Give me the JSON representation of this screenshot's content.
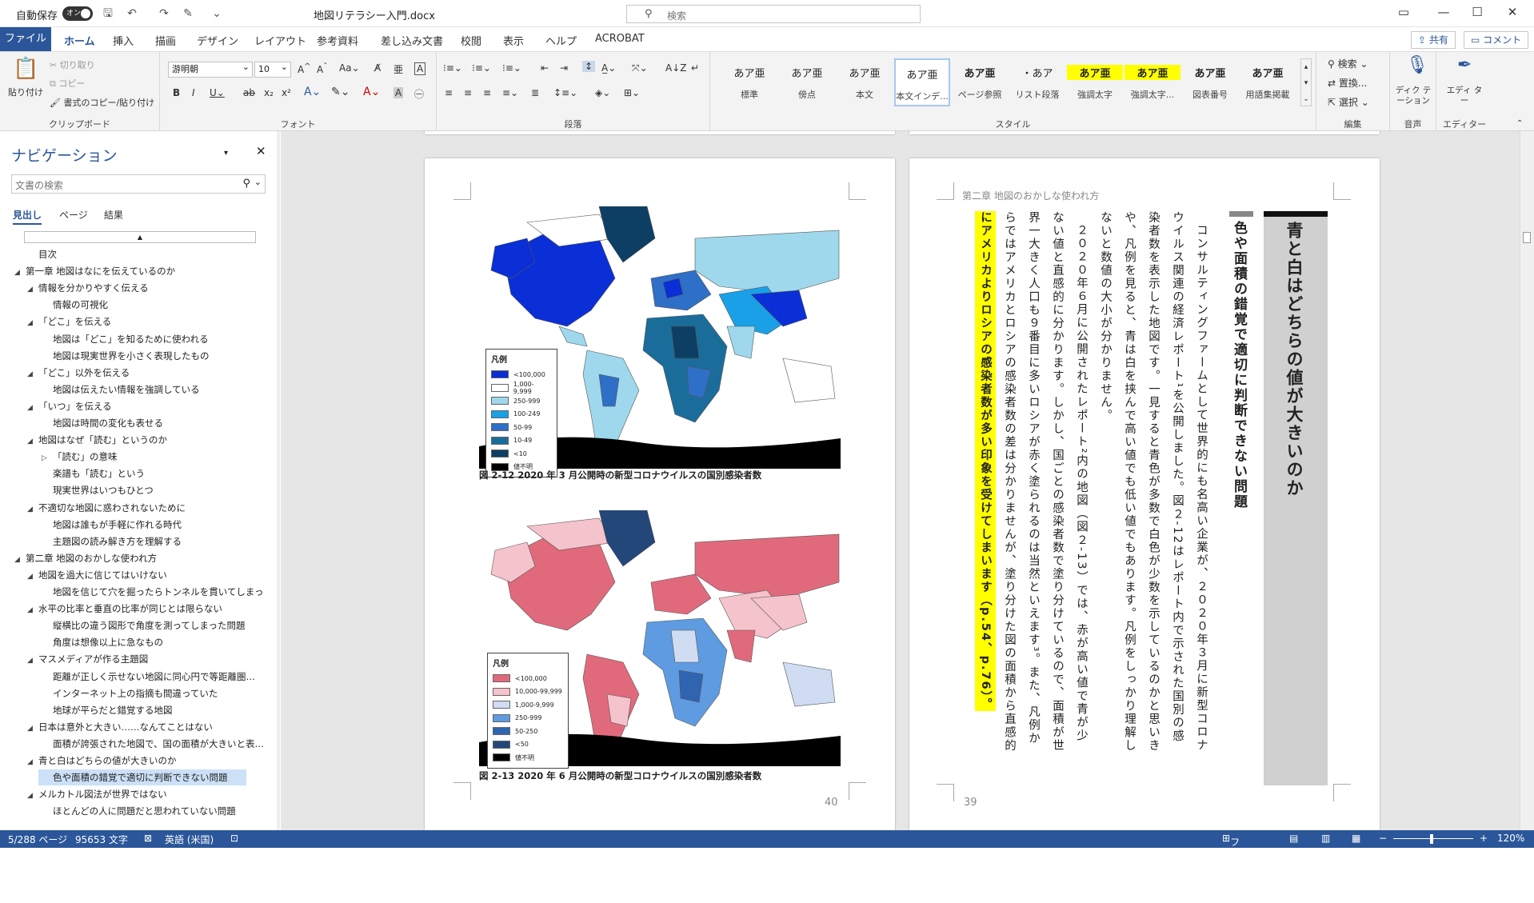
{
  "titlebar": {
    "autosave_label": "自動保存",
    "autosave_state": "オン",
    "doc_title": "地図リテラシー入門.docx",
    "search_placeholder": "検索"
  },
  "tabs": [
    "ファイル",
    "ホーム",
    "挿入",
    "描画",
    "デザイン",
    "レイアウト",
    "参考資料",
    "差し込み文書",
    "校閲",
    "表示",
    "ヘルプ",
    "ACROBAT"
  ],
  "share_label": "共有",
  "comment_label": "コメント",
  "ribbon": {
    "clipboard": {
      "paste": "貼り付け",
      "cut": "切り取り",
      "copy": "コピー",
      "format_painter": "書式のコピー/貼り付け",
      "label": "クリップボード"
    },
    "font": {
      "name": "游明朝",
      "size": "10",
      "label": "フォント"
    },
    "paragraph": {
      "label": "段落"
    },
    "styles": {
      "label": "スタイル",
      "items": [
        {
          "preview": "あア亜",
          "name": "標準"
        },
        {
          "preview": "あア亜",
          "name": "傍点"
        },
        {
          "preview": "あア亜",
          "name": "本文"
        },
        {
          "preview": "あア亜",
          "name": "本文インデ..."
        },
        {
          "preview": "あア亜",
          "name": "ページ参照"
        },
        {
          "preview": "・あア",
          "name": "リスト段落"
        },
        {
          "preview": "あア亜",
          "name": "強調太字"
        },
        {
          "preview": "あア亜",
          "name": "強調太字..."
        },
        {
          "preview": "あア亜",
          "name": "図表番号"
        },
        {
          "preview": "あア亜",
          "name": "用語集掲載"
        }
      ]
    },
    "editing": {
      "search": "検索",
      "replace": "置換...",
      "select": "選択",
      "label": "編集"
    },
    "voice": {
      "dictate": "ディク テーション",
      "label": "音声"
    },
    "editor": {
      "name": "エディ ター",
      "label": "エディター"
    }
  },
  "nav": {
    "title": "ナビゲーション",
    "search_placeholder": "文書の検索",
    "tabs": [
      "見出し",
      "ページ",
      "結果"
    ],
    "items": [
      {
        "level": 2,
        "text": "目次",
        "tri": ""
      },
      {
        "level": 1,
        "text": "第一章 地図はなにを伝えているのか",
        "tri": "◢"
      },
      {
        "level": 2,
        "text": "情報を分かりやすく伝える",
        "tri": "◢"
      },
      {
        "level": 3,
        "text": "情報の可視化",
        "tri": ""
      },
      {
        "level": 2,
        "text": "「どこ」を伝える",
        "tri": "◢"
      },
      {
        "level": 3,
        "text": "地図は「どこ」を知るために使われる",
        "tri": ""
      },
      {
        "level": 3,
        "text": "地図は現実世界を小さく表現したもの",
        "tri": ""
      },
      {
        "level": 2,
        "text": "「どこ」以外を伝える",
        "tri": "◢"
      },
      {
        "level": 3,
        "text": "地図は伝えたい情報を強調している",
        "tri": ""
      },
      {
        "level": 2,
        "text": "「いつ」を伝える",
        "tri": "◢"
      },
      {
        "level": 3,
        "text": "地図は時間の変化も表せる",
        "tri": ""
      },
      {
        "level": 2,
        "text": "地図はなぜ「読む」というのか",
        "tri": "◢"
      },
      {
        "level": 3,
        "text": "「読む」の意味",
        "tri": "▷"
      },
      {
        "level": 3,
        "text": "楽譜も「読む」という",
        "tri": ""
      },
      {
        "level": 3,
        "text": "現実世界はいつもひとつ",
        "tri": ""
      },
      {
        "level": 2,
        "text": "不適切な地図に惑わされないために",
        "tri": "◢"
      },
      {
        "level": 3,
        "text": "地図は誰もが手軽に作れる時代",
        "tri": ""
      },
      {
        "level": 3,
        "text": "主題図の読み解き方を理解する",
        "tri": ""
      },
      {
        "level": 1,
        "text": "第二章 地図のおかしな使われ方",
        "tri": "◢"
      },
      {
        "level": 2,
        "text": "地図を過大に信じてはいけない",
        "tri": "◢"
      },
      {
        "level": 3,
        "text": "地図を信じて穴を掘ったらトンネルを貫いてしまった…",
        "tri": ""
      },
      {
        "level": 2,
        "text": "水平の比率と垂直の比率が同じとは限らない",
        "tri": "◢"
      },
      {
        "level": 3,
        "text": "縦横比の違う図形で角度を測ってしまった問題",
        "tri": ""
      },
      {
        "level": 3,
        "text": "角度は想像以上に急なもの",
        "tri": ""
      },
      {
        "level": 2,
        "text": "マスメディアが作る主題図",
        "tri": "◢"
      },
      {
        "level": 3,
        "text": "距離が正しく示せない地図に同心円で等距離圏…",
        "tri": ""
      },
      {
        "level": 3,
        "text": "インターネット上の指摘も間違っていた",
        "tri": ""
      },
      {
        "level": 3,
        "text": "地球が平らだと錯覚する地図",
        "tri": ""
      },
      {
        "level": 2,
        "text": "日本は意外と大きい……なんてことはない",
        "tri": "◢"
      },
      {
        "level": 3,
        "text": "面積が誇張された地図で、国の面積が大きいと表…",
        "tri": ""
      },
      {
        "level": 2,
        "text": "青と白はどちらの値が大きいのか",
        "tri": "◢"
      },
      {
        "level": 3,
        "text": "色や面積の錯覚で適切に判断できない問題",
        "tri": "",
        "selected": true
      },
      {
        "level": 2,
        "text": "メルカトル図法が世界ではない",
        "tri": "◢"
      },
      {
        "level": 3,
        "text": "ほとんどの人に問題だと思われていない問題",
        "tri": ""
      }
    ]
  },
  "left_page": {
    "map1": {
      "legend_title": "凡例",
      "legend": [
        {
          "label": "<100,000",
          "color": "#0a2fd6"
        },
        {
          "label": "1,000-9,999",
          "color": "#ffffff"
        },
        {
          "label": "250-999",
          "color": "#9fd8ec"
        },
        {
          "label": "100-249",
          "color": "#1aa0e6"
        },
        {
          "label": "50-99",
          "color": "#2e6fc7"
        },
        {
          "label": "10-49",
          "color": "#1a6d9a"
        },
        {
          "label": "<10",
          "color": "#0c3f63"
        },
        {
          "label": "値不明",
          "color": "#000000"
        }
      ],
      "caption": "図 2-12 2020 年 3 月公開時の新型コロナウイルスの国別感染者数"
    },
    "map2": {
      "legend_title": "凡例",
      "legend": [
        {
          "label": "<100,000",
          "color": "#e06a7c"
        },
        {
          "label": "10,000-99,999",
          "color": "#f5c3cb"
        },
        {
          "label": "1,000-9,999",
          "color": "#cfdcf2"
        },
        {
          "label": "250-999",
          "color": "#5f9be0"
        },
        {
          "label": "50-250",
          "color": "#2f64b0"
        },
        {
          "label": "<50",
          "color": "#24477a"
        },
        {
          "label": "値不明",
          "color": "#000000"
        }
      ],
      "caption": "図 2-13 2020 年 6 月公開時の新型コロナウイルスの国別感染者数"
    },
    "page_number": "40"
  },
  "right_page": {
    "running_head": "第二章 地図のおかしな使われ方",
    "chapter_heading": "青と白はどちらの値が大きいのか",
    "section_heading": "色や面積の錯覚で適切に判断できない問題",
    "columns": [
      {
        "text": "コンサルティングファームとして世界的にも名高い企業が、２０２０年３月に新型コロナ",
        "hl": false
      },
      {
        "text": "ウイルス関連の経済レポート¹を公開しました。図２-12はレポート内で示された国別の感",
        "hl": false
      },
      {
        "text": "染者数を表示した地図です。一見すると青色が多数で白色が少数を示しているのかと思いき",
        "hl": false
      },
      {
        "text": "や、凡例を見ると、青は白を挟んで高い値でも低い値でもあります。凡例をしっかり理解し",
        "hl": false
      },
      {
        "text": "ないと数値の大小が分かりません。",
        "hl": false
      },
      {
        "text": "２０２０年６月に公開されたレポート²内の地図（図２-13）では、赤が高い値で青が少",
        "hl": false
      },
      {
        "text": "ない値と直感的に分かります。しかし、国ごとの感染者数で塗り分けているので、面積が世",
        "hl": false
      },
      {
        "text": "界一大きく人口も９番目に多いロシアが赤く塗られるのは当然といえます³。また、凡例か",
        "hl": false
      },
      {
        "text": "らではアメリカとロシアの感染者数の差は分かりませんが、塗り分けた図の面積から直感的",
        "hl": false
      },
      {
        "text": "にアメリカよりロシアの感染者数が多い印象を受けてしまいます（p.54、p.76）。",
        "hl": true
      }
    ],
    "page_number": "39"
  },
  "status": {
    "page": "5/288 ページ",
    "words": "95653 文字",
    "lang": "英語 (米国)",
    "focus": "フォーカス",
    "zoom": "120%"
  }
}
